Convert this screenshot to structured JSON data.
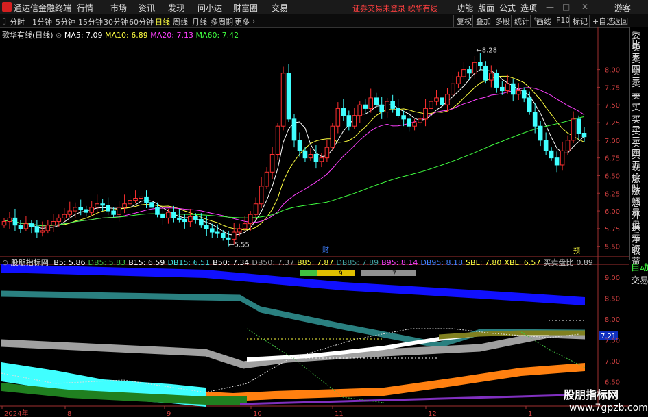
{
  "topbar": {
    "app_name": "通达信金融终端",
    "menus": [
      "行情",
      "市场",
      "资讯",
      "发现",
      "问小达",
      "财富圈",
      "交易"
    ],
    "warning": "证券交易未登录  歌华有线",
    "right_menus": [
      "功能",
      "版面",
      "公式",
      "选项"
    ],
    "guest": "游客"
  },
  "periods": [
    "分时",
    "1分钟",
    "5分钟",
    "15分钟",
    "30分钟",
    "60分钟",
    "日线",
    "周线",
    "月线",
    "多周期",
    "更多"
  ],
  "active_period": "日线",
  "toolbar_right": [
    "复权",
    "叠加",
    "多股",
    "统计",
    "画线",
    "F10",
    "标记",
    "+自选",
    "返回"
  ],
  "main_info": {
    "stock": "歌华有线(日线)",
    "ma5": "MA5: 7.09",
    "ma10": "MA10: 6.89",
    "ma20": "MA20: 7.13",
    "ma60": "MA60: 7.42"
  },
  "indicator_info": {
    "name": "股朋指标网",
    "items": [
      {
        "t": "B5: 5.86",
        "c": "#ffffff"
      },
      {
        "t": "DB5: 5.83",
        "c": "#40c040"
      },
      {
        "t": "B15: 6.59",
        "c": "#ffffff"
      },
      {
        "t": "DB15: 6.51",
        "c": "#40e0e0"
      },
      {
        "t": "B50: 7.34",
        "c": "#ffffff"
      },
      {
        "t": "DB50: 7.37",
        "c": "#a0a0a0"
      },
      {
        "t": "B85: 7.87",
        "c": "#ffff40"
      },
      {
        "t": "DB85: 7.89",
        "c": "#40a0a0"
      },
      {
        "t": "B95: 8.14",
        "c": "#ff40ff"
      },
      {
        "t": "DB95: 8.18",
        "c": "#4080ff"
      },
      {
        "t": "SBL: 7.80",
        "c": "#ffff40"
      },
      {
        "t": "XBL: 6.57",
        "c": "#ffff40"
      },
      {
        "t": "买卖盘比",
        "c": "#c0c0c0"
      },
      {
        "t": "0.89",
        "c": "#c0c0c0"
      }
    ]
  },
  "right_panel": [
    "委比",
    "卖五",
    "卖四",
    "卖三",
    "卖二",
    "卖一",
    "买一",
    "买二",
    "买三",
    "买四",
    "买五",
    "现价",
    "涨跌",
    "涨幅",
    "总量",
    "外盘",
    "换手",
    "净资",
    "收益"
  ],
  "right_panel_lower": [
    "自动",
    "交易"
  ],
  "chart_data": {
    "type": "candlestick",
    "price_axis": {
      "min": 5.4,
      "max": 8.5,
      "ticks": [
        "8.00",
        "7.75",
        "7.50",
        "7.25",
        "7.00",
        "6.75",
        "6.50",
        "6.25",
        "6.00",
        "5.75",
        "5.50"
      ]
    },
    "indicator_axis": {
      "ticks": [
        "9.00",
        "8.50",
        "8.00",
        "7.50",
        "7.00",
        "6.50"
      ]
    },
    "time_axis_labels": [
      "2024年",
      "8",
      "9",
      "10",
      "11",
      "12",
      "1"
    ],
    "high_label": "8.28",
    "low_label": "5.55",
    "markers": [
      "财",
      "预"
    ],
    "indicator_ratio": {
      "green": "9",
      "grey": "7"
    },
    "xbl_current": "7.21",
    "closes": [
      5.85,
      5.9,
      5.8,
      5.75,
      5.82,
      5.78,
      5.7,
      5.72,
      5.8,
      5.85,
      5.9,
      5.95,
      6.0,
      6.05,
      6.02,
      5.98,
      6.05,
      6.1,
      6.08,
      6.0,
      5.95,
      6.05,
      6.1,
      6.15,
      6.18,
      6.2,
      6.12,
      6.05,
      5.95,
      5.9,
      5.98,
      5.9,
      5.88,
      5.85,
      5.92,
      5.88,
      5.8,
      5.75,
      5.7,
      5.68,
      5.62,
      5.6,
      5.7,
      5.75,
      5.82,
      5.95,
      6.1,
      6.35,
      6.55,
      6.8,
      7.2,
      7.95,
      7.3,
      7.0,
      6.85,
      6.75,
      6.8,
      6.7,
      6.75,
      6.9,
      7.2,
      7.45,
      7.35,
      7.2,
      7.35,
      7.5,
      7.45,
      7.6,
      7.5,
      7.4,
      7.55,
      7.45,
      7.35,
      7.3,
      7.2,
      7.25,
      7.3,
      7.45,
      7.55,
      7.6,
      7.5,
      7.65,
      7.8,
      7.9,
      8.0,
      7.95,
      8.1,
      8.05,
      7.85,
      7.95,
      7.75,
      7.7,
      7.8,
      7.65,
      7.7,
      7.6,
      7.4,
      7.2,
      7.0,
      6.85,
      6.75,
      6.65,
      6.85,
      7.0,
      7.3,
      7.1,
      7.05
    ]
  }
}
